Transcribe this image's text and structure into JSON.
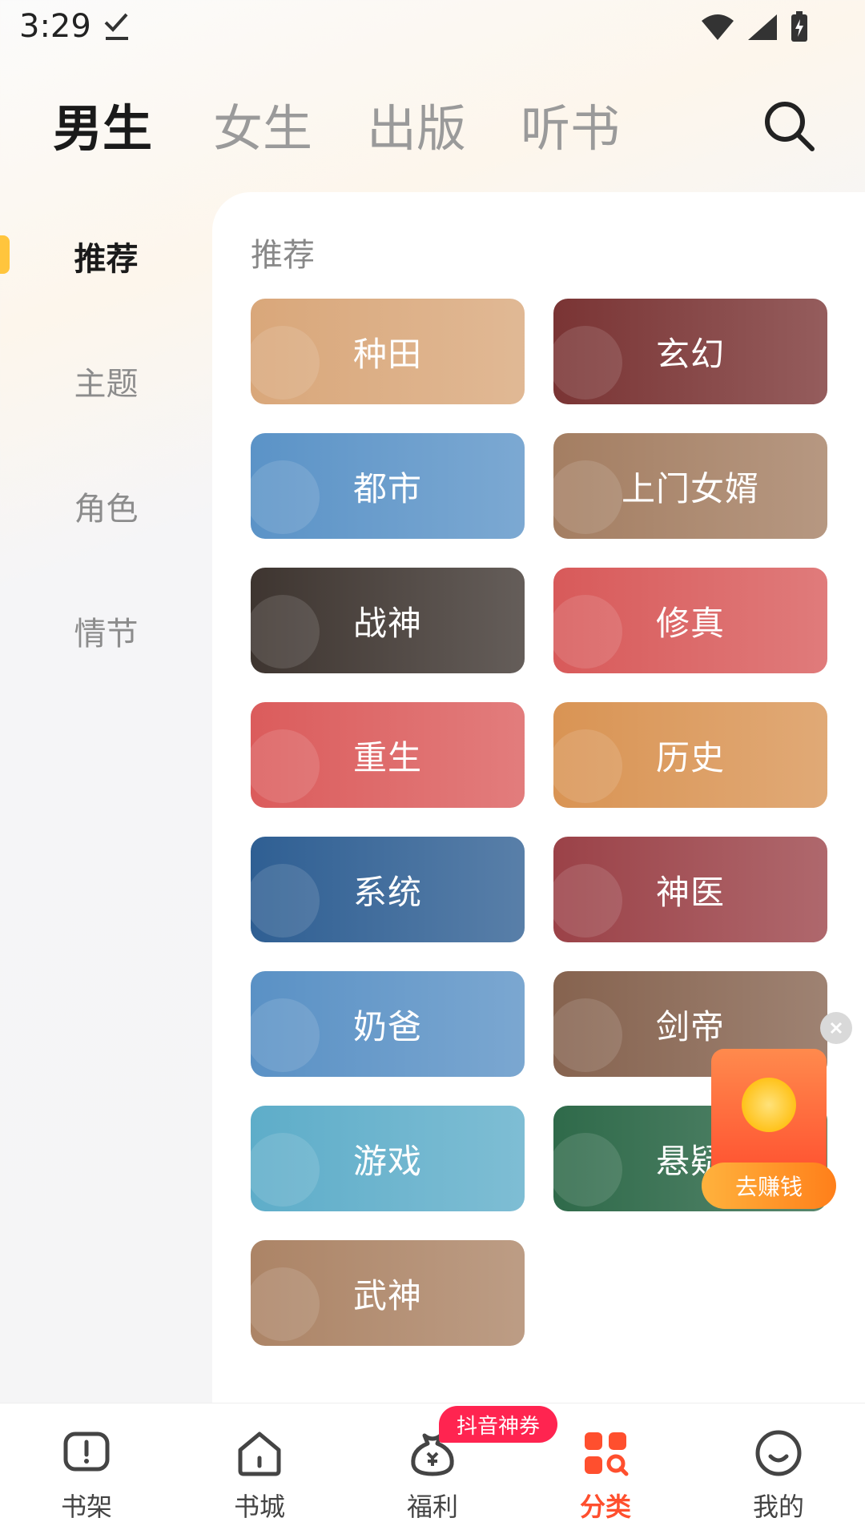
{
  "status_bar": {
    "time": "3:29"
  },
  "top_tabs": [
    "男生",
    "女生",
    "出版",
    "听书"
  ],
  "sidebar": {
    "items": [
      "推荐",
      "主题",
      "角色",
      "情节"
    ]
  },
  "panel": {
    "title": "推荐",
    "categories": [
      {
        "label": "种田",
        "color": "#d9a77a"
      },
      {
        "label": "玄幻",
        "color": "#7a3434"
      },
      {
        "label": "都市",
        "color": "#5b93c7"
      },
      {
        "label": "上门女婿",
        "color": "#a47e62"
      },
      {
        "label": "战神",
        "color": "#3e3530"
      },
      {
        "label": "修真",
        "color": "#d85a5a"
      },
      {
        "label": "重生",
        "color": "#db5c5c"
      },
      {
        "label": "历史",
        "color": "#d99454"
      },
      {
        "label": "系统",
        "color": "#2f5f93"
      },
      {
        "label": "神医",
        "color": "#9b4248"
      },
      {
        "label": "奶爸",
        "color": "#5a91c5"
      },
      {
        "label": "剑帝",
        "color": "#86634f"
      },
      {
        "label": "游戏",
        "color": "#5eadc9"
      },
      {
        "label": "悬疑",
        "color": "#2f6a4a"
      },
      {
        "label": "武神",
        "color": "#ac8466"
      }
    ]
  },
  "floating": {
    "earn_label": "去赚钱"
  },
  "bottom_nav": {
    "items": [
      "书架",
      "书城",
      "福利",
      "分类",
      "我的"
    ],
    "badge": "抖音神券",
    "accent": "#ff4f2e"
  }
}
